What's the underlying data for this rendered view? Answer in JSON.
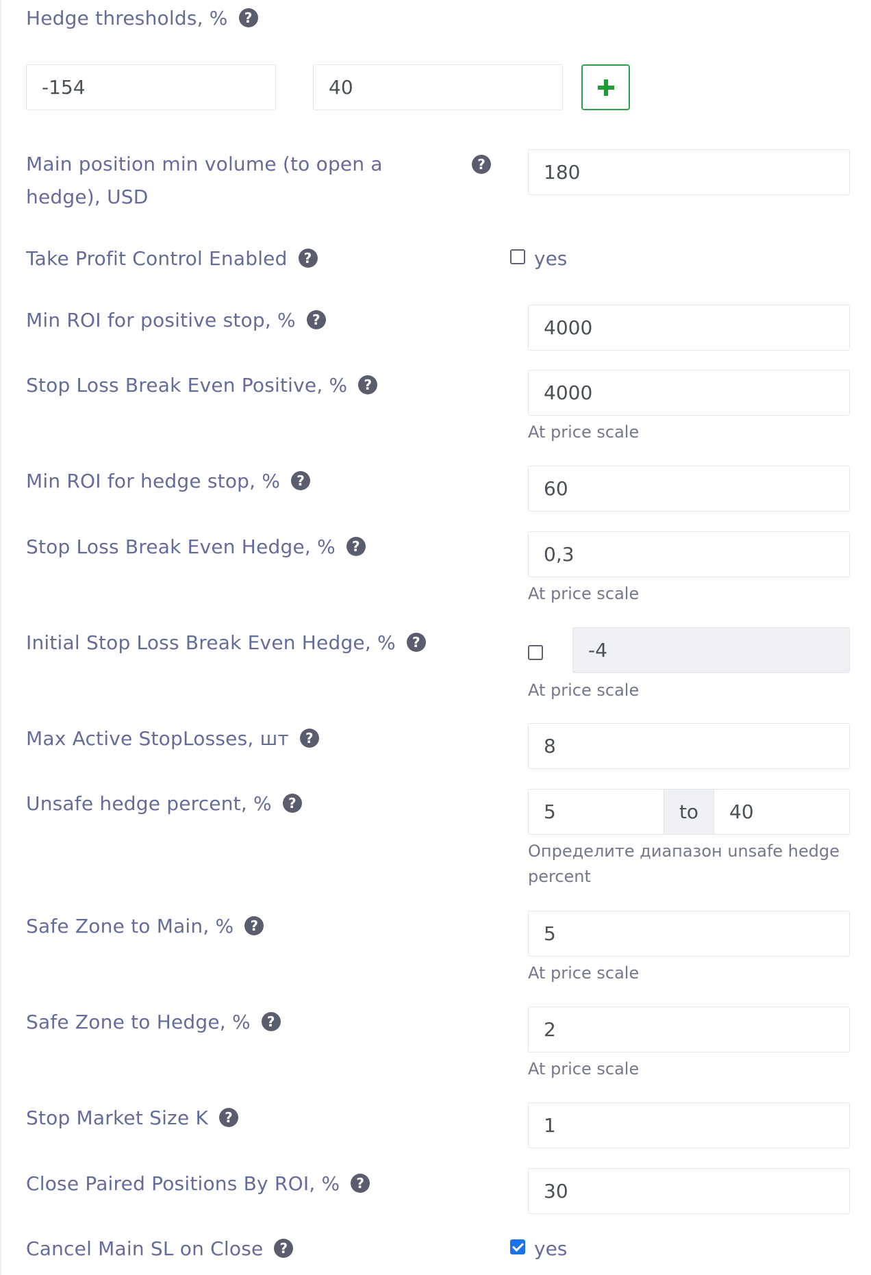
{
  "hedge_thresholds": {
    "label": "Hedge thresholds, %",
    "value_1": "-154",
    "value_2": "40",
    "add_icon": "plus-icon"
  },
  "main_position_min_volume": {
    "label": "Main position min volume (to open a hedge), USD",
    "value": "180"
  },
  "take_profit_control": {
    "label": "Take Profit Control Enabled",
    "checkbox_label": "yes",
    "checked": false
  },
  "min_roi_positive_stop": {
    "label": "Min ROI for positive stop, %",
    "value": "4000"
  },
  "stop_loss_break_even_positive": {
    "label": "Stop Loss Break Even Positive, %",
    "value": "4000",
    "hint": "At price scale"
  },
  "min_roi_hedge_stop": {
    "label": "Min ROI for hedge stop, %",
    "value": "60"
  },
  "stop_loss_break_even_hedge": {
    "label": "Stop Loss Break Even Hedge, %",
    "value": "0,3",
    "hint": "At price scale"
  },
  "initial_stop_loss_break_even_hedge": {
    "label": "Initial Stop Loss Break Even Hedge, %",
    "checked": false,
    "value": "-4",
    "hint": "At price scale"
  },
  "max_active_stoplosses": {
    "label": "Max Active StopLosses, шт",
    "value": "8"
  },
  "unsafe_hedge_percent": {
    "label": "Unsafe hedge percent, %",
    "from": "5",
    "to_label": "to",
    "to": "40",
    "hint": "Определите диапазон unsafe hedge percent"
  },
  "safe_zone_to_main": {
    "label": "Safe Zone to Main, %",
    "value": "5",
    "hint": "At price scale"
  },
  "safe_zone_to_hedge": {
    "label": "Safe Zone to Hedge, %",
    "value": "2",
    "hint": "At price scale"
  },
  "stop_market_size_k": {
    "label": "Stop Market Size K",
    "value": "1"
  },
  "close_paired_positions_by_roi": {
    "label": "Close Paired Positions By ROI, %",
    "value": "30"
  },
  "cancel_main_sl_on_close": {
    "label": "Cancel Main SL on Close",
    "checkbox_label": "yes",
    "checked": true
  },
  "help_icon": "question-circle-icon"
}
